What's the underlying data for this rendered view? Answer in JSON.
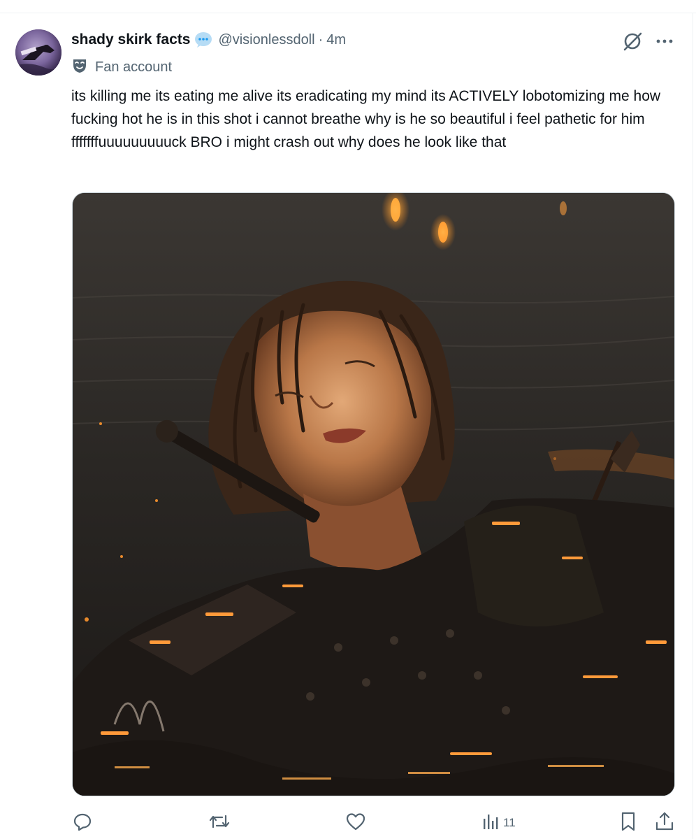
{
  "author": {
    "display_name": "shady skirk facts",
    "handle": "@visionlessdoll",
    "separator": "·",
    "time": "4m",
    "affiliation_label": "Fan account",
    "avatar_icon": "avatar-image",
    "badge_icon": "speech-bubble-icon"
  },
  "tweet": {
    "text": "its killing me its eating me alive its eradicating my mind its ACTIVELY lobotomizing me how fucking hot he is in this shot i cannot breathe why is he so beautiful i feel pathetic for him fffffffuuuuuuuuuck BRO i might crash out why does he look like that"
  },
  "media": {
    "description_icon": "photo"
  },
  "actions": {
    "reply_icon": "reply-icon",
    "repost_icon": "repost-icon",
    "like_icon": "heart-icon",
    "views_icon": "views-icon",
    "views_count": "11",
    "bookmark_icon": "bookmark-icon",
    "share_icon": "share-icon"
  },
  "colors": {
    "text_primary": "#0f1419",
    "text_secondary": "#536471",
    "divider": "#eff3f4",
    "badge_blue": "#1d9bf0"
  }
}
